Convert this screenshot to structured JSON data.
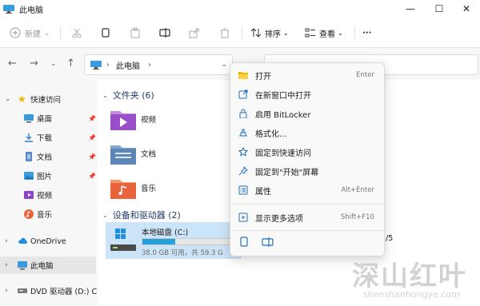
{
  "window": {
    "title": "此电脑",
    "controls": {
      "minimize": "—",
      "maximize": "☐",
      "close": "✕"
    }
  },
  "toolbar": {
    "new_label": "新建",
    "sort_label": "排序",
    "view_label": "查看",
    "more_label": "···"
  },
  "address": {
    "path": "此电脑",
    "separator": "›"
  },
  "sidebar": {
    "quick_access": "快速访问",
    "items": [
      {
        "label": "桌面",
        "icon": "desktop-icon",
        "pinned": true
      },
      {
        "label": "下载",
        "icon": "download-icon",
        "pinned": true
      },
      {
        "label": "文档",
        "icon": "document-icon",
        "pinned": true
      },
      {
        "label": "图片",
        "icon": "picture-icon",
        "pinned": true
      },
      {
        "label": "视频",
        "icon": "video-icon",
        "pinned": false
      },
      {
        "label": "音乐",
        "icon": "music-icon",
        "pinned": false
      }
    ],
    "onedrive": "OneDrive",
    "this_pc": "此电脑",
    "dvd": "DVD 驱动器 (D:) C("
  },
  "main": {
    "folders_header": "文件夹 (6)",
    "folders": [
      {
        "label": "视频",
        "icon": "video-folder-icon"
      },
      {
        "label": "文档",
        "icon": "document-folder-icon"
      },
      {
        "label": "音乐",
        "icon": "music-folder-icon"
      }
    ],
    "drives_header": "设备和驱动器 (2)",
    "drive": {
      "name": "本地磁盘 (C:)",
      "info": "38.0 GB 可用，共 59.3 G",
      "used_fraction": 0.36
    },
    "other_drive_text": "/5"
  },
  "context_menu": {
    "items": [
      {
        "label": "打开",
        "shortcut": "Enter",
        "icon": "folder-open-icon"
      },
      {
        "label": "在新窗口中打开",
        "shortcut": "",
        "icon": "new-window-icon"
      },
      {
        "label": "启用 BitLocker",
        "shortcut": "",
        "icon": "lock-icon"
      },
      {
        "label": "格式化...",
        "shortcut": "",
        "icon": "format-icon"
      },
      {
        "label": "固定到快速访问",
        "shortcut": "",
        "icon": "star-icon"
      },
      {
        "label": "固定到\"开始\"屏幕",
        "shortcut": "",
        "icon": "pin-icon"
      },
      {
        "label": "属性",
        "shortcut": "Alt+Enter",
        "icon": "properties-icon"
      },
      {
        "label": "显示更多选项",
        "shortcut": "Shift+F10",
        "icon": "more-options-icon"
      }
    ]
  },
  "watermark": {
    "cn": "深山红叶",
    "en": "shenshanhongye.com"
  },
  "colors": {
    "accent": "#0078d4",
    "drive_fill": "#26a0da",
    "selected_bg": "#cce4f7"
  }
}
